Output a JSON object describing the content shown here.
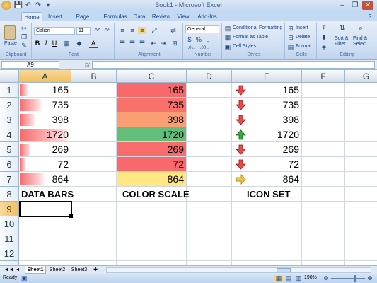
{
  "window": {
    "title": "Book1 - Microsoft Excel"
  },
  "qat": {
    "save": "💾",
    "undo": "↶",
    "redo": "↷",
    "more": "▾"
  },
  "window_buttons": {
    "minimize": "–",
    "restore": "❐",
    "close": "✕"
  },
  "ribbon": {
    "tabs": [
      "Home",
      "Insert",
      "Page Layout",
      "Formulas",
      "Data",
      "Review",
      "View",
      "Add-Ins"
    ],
    "help": "?",
    "clipboard": {
      "paste": "Paste",
      "label": "Clipboard"
    },
    "font": {
      "name": "Calibri",
      "size": "11",
      "grow": "A˄",
      "shrink": "A˅",
      "bold": "B",
      "italic": "I",
      "underline": "U",
      "label": "Font"
    },
    "alignment": {
      "label": "Alignment"
    },
    "number": {
      "format": "General",
      "currency": "$",
      "percent": "%",
      "comma": ",",
      "label": "Number"
    },
    "styles": {
      "conditional": "Conditional Formatting",
      "table": "Format as Table",
      "cell": "Cell Styles",
      "label": "Styles"
    },
    "cells": {
      "insert": "Insert",
      "delete": "Delete",
      "format": "Format",
      "label": "Cells"
    },
    "editing": {
      "sum": "Σ",
      "sort": "Sort &",
      "filter": "Filter",
      "find": "Find &",
      "select": "Select",
      "label": "Editing"
    }
  },
  "formula_bar": {
    "name_box": "A9",
    "fx": "fx",
    "value": ""
  },
  "grid": {
    "columns": [
      "A",
      "B",
      "C",
      "D",
      "E",
      "F",
      "G"
    ],
    "selected_column": "A",
    "rows": [
      "1",
      "2",
      "3",
      "4",
      "5",
      "6",
      "7",
      "8",
      "9",
      "10",
      "11",
      "12",
      "13"
    ],
    "selected_row": "9",
    "values": [
      "165",
      "735",
      "398",
      "1720",
      "269",
      "72",
      "864"
    ],
    "data_bar_fractions": [
      0.16,
      0.45,
      0.3,
      1.0,
      0.22,
      0.12,
      0.5
    ],
    "color_scale_colors": [
      "#f8696b",
      "#f8726b",
      "#fa9e73",
      "#63be7b",
      "#f86c6b",
      "#f8696b",
      "#ffe783"
    ],
    "icon_names": [
      "down-arrow-icon",
      "down-arrow-icon",
      "down-arrow-icon",
      "up-arrow-icon",
      "down-arrow-icon",
      "down-arrow-icon",
      "right-arrow-icon"
    ],
    "labels": {
      "data_bars": "DATA BARS",
      "color_scale": "COLOR SCALE",
      "icon_set": "ICON SET"
    }
  },
  "sheets": [
    "Sheet1",
    "Sheet2",
    "Sheet3"
  ],
  "status": {
    "ready": "Ready",
    "zoom": "190%"
  }
}
